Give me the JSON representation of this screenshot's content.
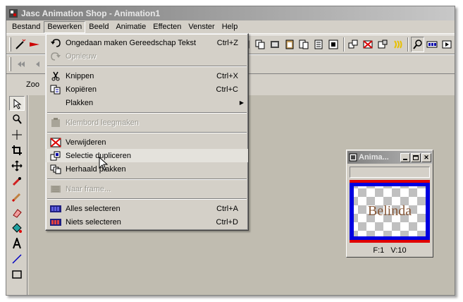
{
  "window": {
    "title": "Jasc Animation Shop - Animation1"
  },
  "menubar": {
    "items": [
      "Bestand",
      "Bewerken",
      "Beeld",
      "Animatie",
      "Effecten",
      "Venster",
      "Help"
    ]
  },
  "zoom": {
    "label": "Zoo"
  },
  "edit_menu": {
    "items": [
      {
        "label": "Ongedaan maken Gereedschap Tekst",
        "shortcut": "Ctrl+Z",
        "disabled": false,
        "icon": "undo-icon"
      },
      {
        "label": "Opnieuw",
        "shortcut": "",
        "disabled": true,
        "icon": "redo-icon"
      },
      {
        "label": "Knippen",
        "shortcut": "Ctrl+X",
        "disabled": false,
        "icon": "scissors-icon"
      },
      {
        "label": "Kopiëren",
        "shortcut": "Ctrl+C",
        "disabled": false,
        "icon": "copy-icon"
      },
      {
        "label": "Plakken",
        "shortcut": "",
        "disabled": false,
        "icon": "",
        "submenu": true
      },
      {
        "label": "Klembord leegmaken",
        "shortcut": "",
        "disabled": true,
        "icon": "clipboard-icon"
      },
      {
        "label": "Verwijderen",
        "shortcut": "",
        "disabled": false,
        "icon": "delete-frame-icon"
      },
      {
        "label": "Selectie dupliceren",
        "shortcut": "",
        "disabled": false,
        "icon": "duplicate-icon",
        "hovered": true
      },
      {
        "label": "Herhaald plakken",
        "shortcut": "",
        "disabled": false,
        "icon": "repeat-paste-icon"
      },
      {
        "label": "Naar frame...",
        "shortcut": "",
        "disabled": true,
        "icon": "goto-frame-icon"
      },
      {
        "label": "Alles selecteren",
        "shortcut": "Ctrl+A",
        "disabled": false,
        "icon": "select-all-icon"
      },
      {
        "label": "Niets selecteren",
        "shortcut": "Ctrl+D",
        "disabled": false,
        "icon": "select-none-icon"
      }
    ]
  },
  "animation_window": {
    "title": "Anima...",
    "canvas_text": "Belinda",
    "frame": "F:1",
    "delay": "V:10"
  },
  "colors": {
    "face": "#d4d0c8",
    "workspace": "#c0bcb0",
    "frame_red": "#e00000",
    "frame_blue": "#0000e0",
    "belinda_text": "#8a5a3a"
  }
}
